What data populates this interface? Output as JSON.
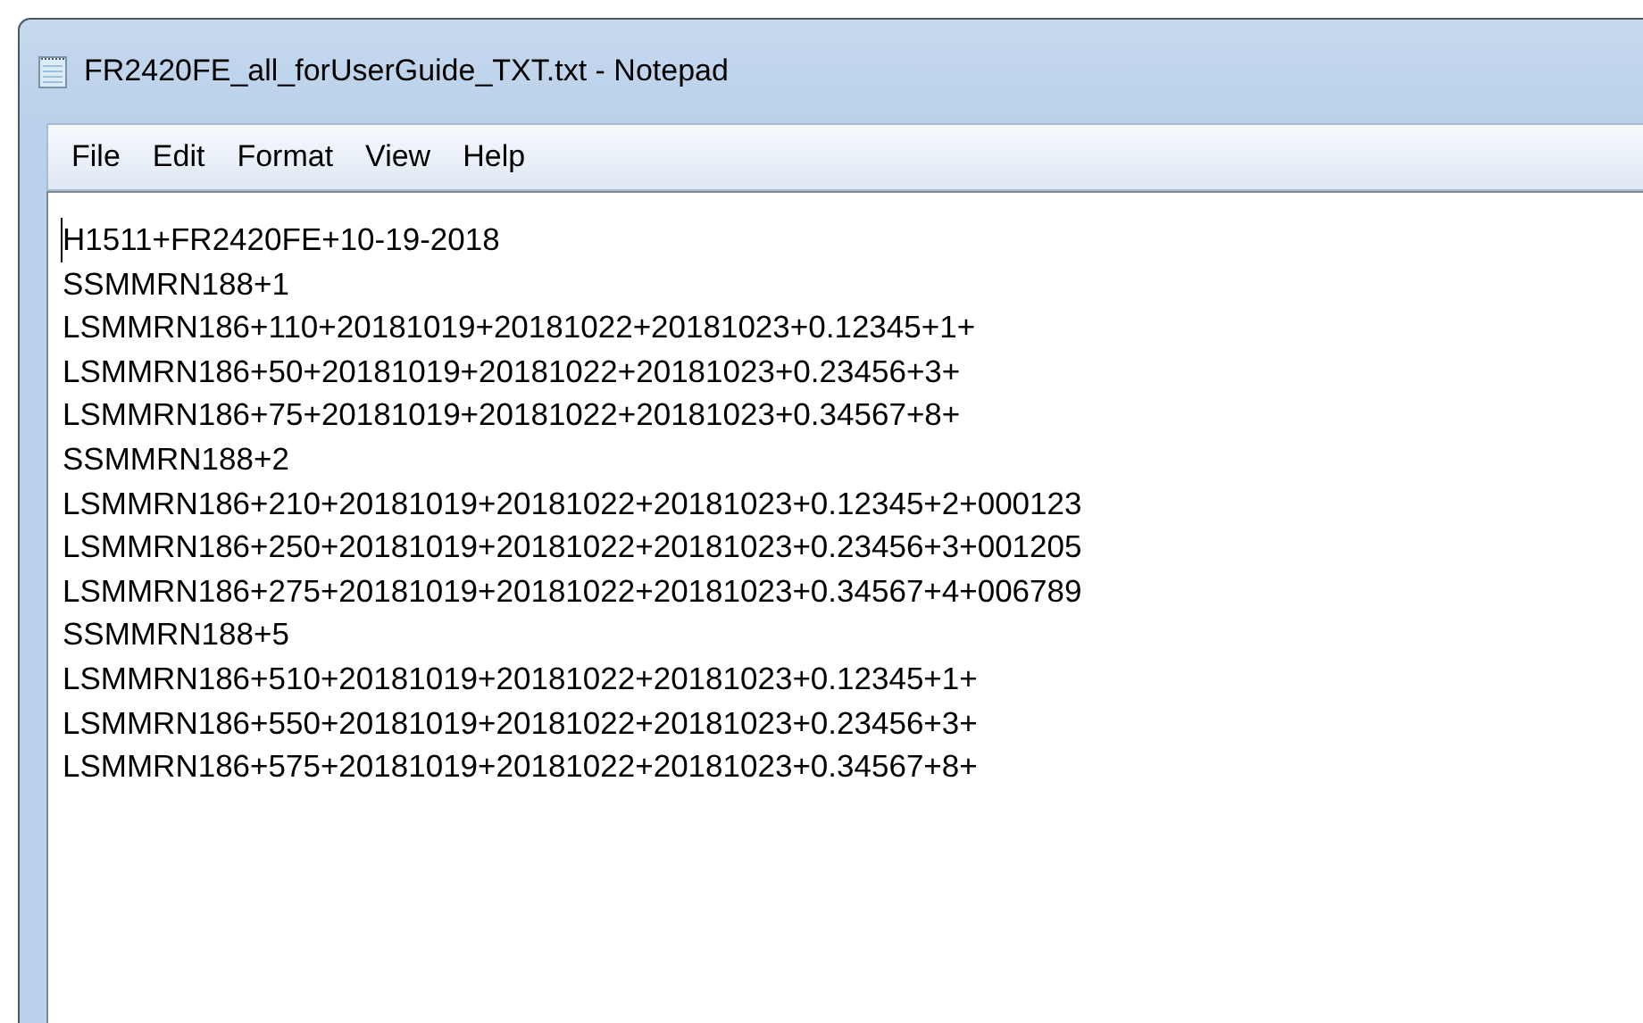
{
  "window": {
    "title": "FR2420FE_all_forUserGuide_TXT.txt - Notepad"
  },
  "menu": [
    "File",
    "Edit",
    "Format",
    "View",
    "Help"
  ],
  "lines": [
    "H1511+FR2420FE+10-19-2018",
    "SSMMRN188+1",
    "LSMMRN186+110+20181019+20181022+20181023+0.12345+1+",
    "LSMMRN186+50+20181019+20181022+20181023+0.23456+3+",
    "LSMMRN186+75+20181019+20181022+20181023+0.34567+8+",
    "SSMMRN188+2",
    "LSMMRN186+210+20181019+20181022+20181023+0.12345+2+000123",
    "LSMMRN186+250+20181019+20181022+20181023+0.23456+3+001205",
    "LSMMRN186+275+20181019+20181022+20181023+0.34567+4+006789",
    "SSMMRN188+5",
    "LSMMRN186+510+20181019+20181022+20181023+0.12345+1+",
    "LSMMRN186+550+20181019+20181022+20181023+0.23456+3+",
    "LSMMRN186+575+20181019+20181022+20181023+0.34567+8+"
  ]
}
